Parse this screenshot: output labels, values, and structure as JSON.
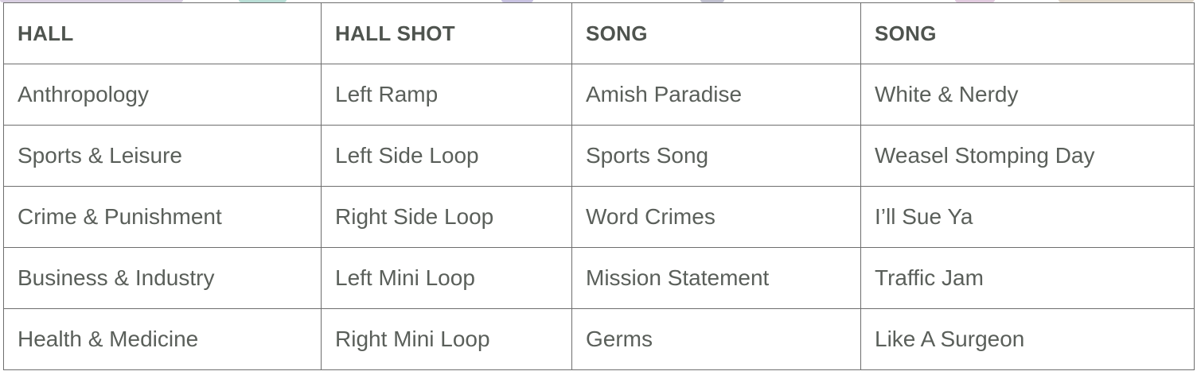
{
  "table": {
    "headers": [
      "HALL",
      "HALL SHOT",
      "SONG",
      "SONG"
    ],
    "rows": [
      [
        "Anthropology",
        "Left Ramp",
        "Amish Paradise",
        "White & Nerdy"
      ],
      [
        "Sports & Leisure",
        "Left Side Loop",
        "Sports Song",
        "Weasel Stomping Day"
      ],
      [
        "Crime & Punishment",
        "Right Side Loop",
        "Word Crimes",
        "I’ll Sue Ya"
      ],
      [
        "Business & Industry",
        "Left Mini Loop",
        "Mission Statement",
        "Traffic Jam"
      ],
      [
        "Health & Medicine",
        "Right Mini Loop",
        "Germs",
        "Like A Surgeon"
      ]
    ]
  },
  "colors": {
    "text": "#555a55",
    "border": "#6e6e6e",
    "background": "#ffffff"
  }
}
